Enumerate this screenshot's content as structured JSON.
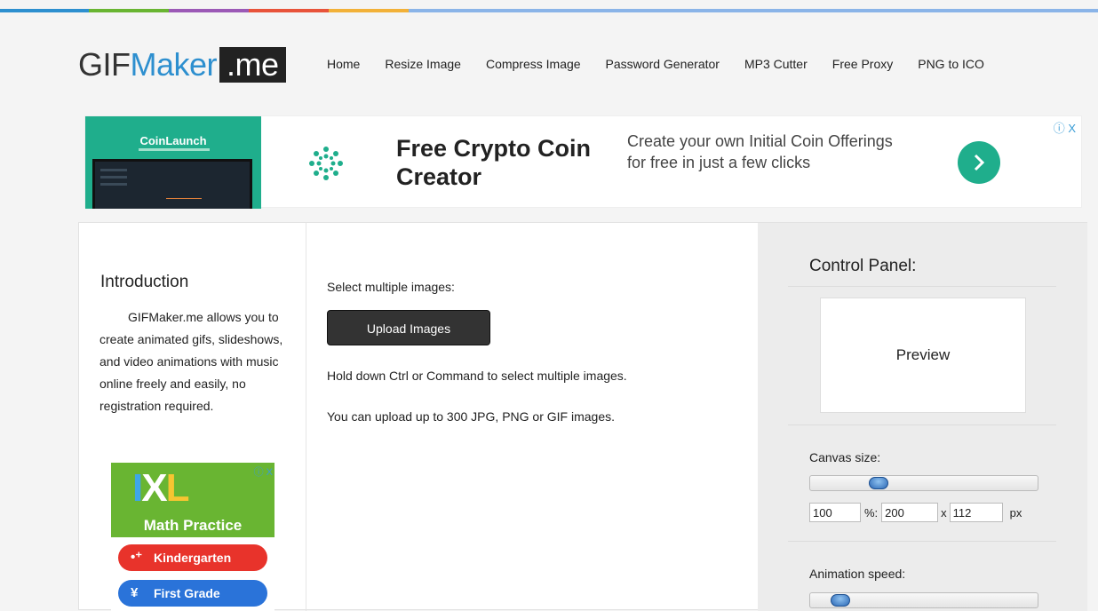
{
  "colors": {
    "strip": [
      "#2d8fcf",
      "#69b532",
      "#9b59b6",
      "#e8533a",
      "#f2b138",
      "#8ab4e8"
    ],
    "accent": "#2d8fcf",
    "ad_green": "#1fae8c"
  },
  "logo": {
    "part1": "GIF",
    "part2": "Maker",
    "part3": ".me"
  },
  "nav": [
    "Home",
    "Resize Image",
    "Compress Image",
    "Password Generator",
    "MP3 Cutter",
    "Free Proxy",
    "PNG to ICO"
  ],
  "ad": {
    "brand": "CoinLaunch",
    "title": "Free Crypto Coin Creator",
    "description": "Create your own Initial Coin Offerings for free in just a few clicks",
    "choices": "ⓘ X",
    "go_icon": "chevron-right-icon"
  },
  "intro": {
    "heading": "Introduction",
    "text": "GIFMaker.me allows you to create animated gifs, slideshows, and video animations with music online freely and easily, no registration required."
  },
  "side_ad": {
    "brand": "IXL",
    "subtitle": "Math Practice",
    "items": [
      "Kindergarten",
      "First Grade"
    ],
    "choices": "ⓘ X"
  },
  "upload": {
    "select_label": "Select multiple images:",
    "button": "Upload Images",
    "hint1": "Hold down Ctrl or Command to select multiple images.",
    "hint2": "You can upload up to 300 JPG, PNG or GIF images."
  },
  "control_panel": {
    "title": "Control Panel:",
    "preview": "Preview",
    "canvas_label": "Canvas size:",
    "canvas_slider_fraction": 0.28,
    "percent_value": "100",
    "percent_sep": "%:",
    "width_value": "200",
    "x_sep": "x",
    "height_value": "112",
    "unit": "px",
    "speed_label": "Animation speed:",
    "speed_slider_fraction": 0.1
  }
}
